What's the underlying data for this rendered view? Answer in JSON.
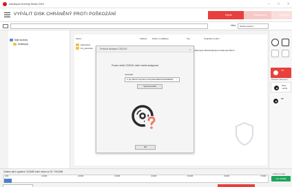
{
  "window": {
    "title": "Ashampoo Burning Studio 2016"
  },
  "header": {
    "title": "VYPÁLIT DISK CHRÁNĚNÝ PROTI POŠKOZÁNÍ",
    "steps": [
      "Výběr",
      "Nastavení",
      "Vypálení"
    ]
  },
  "pathbar": {
    "path": "",
    "search_label": "Hled",
    "search_placeholder": "Hledat soubory"
  },
  "tree": {
    "items": [
      "Moje soubory",
      "Ashampoo"
    ]
  },
  "filelist": {
    "columns": [
      "Název",
      "Velikost",
      "Datum modifikace",
      "Typ",
      "Originální soubor"
    ],
    "rows": [
      {
        "name": "Ashampoo",
        "size": "",
        "date": "",
        "type": "",
        "original": ""
      },
      {
        "name": "1A_prerezani",
        "size": "1 KB",
        "date": "",
        "type": "",
        "original": "Ashampoo files\\Ashampoo Ashampoo Burni"
      }
    ]
  },
  "dialog": {
    "title": "Probíhá vkládání CD/DVD",
    "message": "Prosím vložte CD/DVD, které chcete analyzovat.",
    "drive_label": "Jednotka",
    "drive_value": "F: [E:] BD-RT Rychlost N/A [MAGNETKDR BA6BFS]",
    "eject_label": "Vysunout disk",
    "ok_label": "OK"
  },
  "right_toolbar": {
    "section_label": "Přesah zobrazení",
    "tiles": [
      {
        "label": "CD",
        "active": true
      },
      {
        "label": "DVD\n+DVD",
        "active": false
      },
      {
        "label": "BD",
        "active": false
      }
    ]
  },
  "status": {
    "text": "Celkem dat k vypálení: 20,0MB  Volné místo na CD: 700,0MB",
    "ticks": [
      "0MB",
      "100MB",
      "200MB",
      "300MB",
      "400MB",
      "500MB",
      "600MB",
      "700MB"
    ],
    "fill_fraction": 0.03,
    "disc_type_label": "Velikost média",
    "disc_type_value": "CD 700MB"
  },
  "colors": {
    "accent": "#e8403c",
    "progress": "#4a83c4",
    "ok": "#1da55a"
  }
}
